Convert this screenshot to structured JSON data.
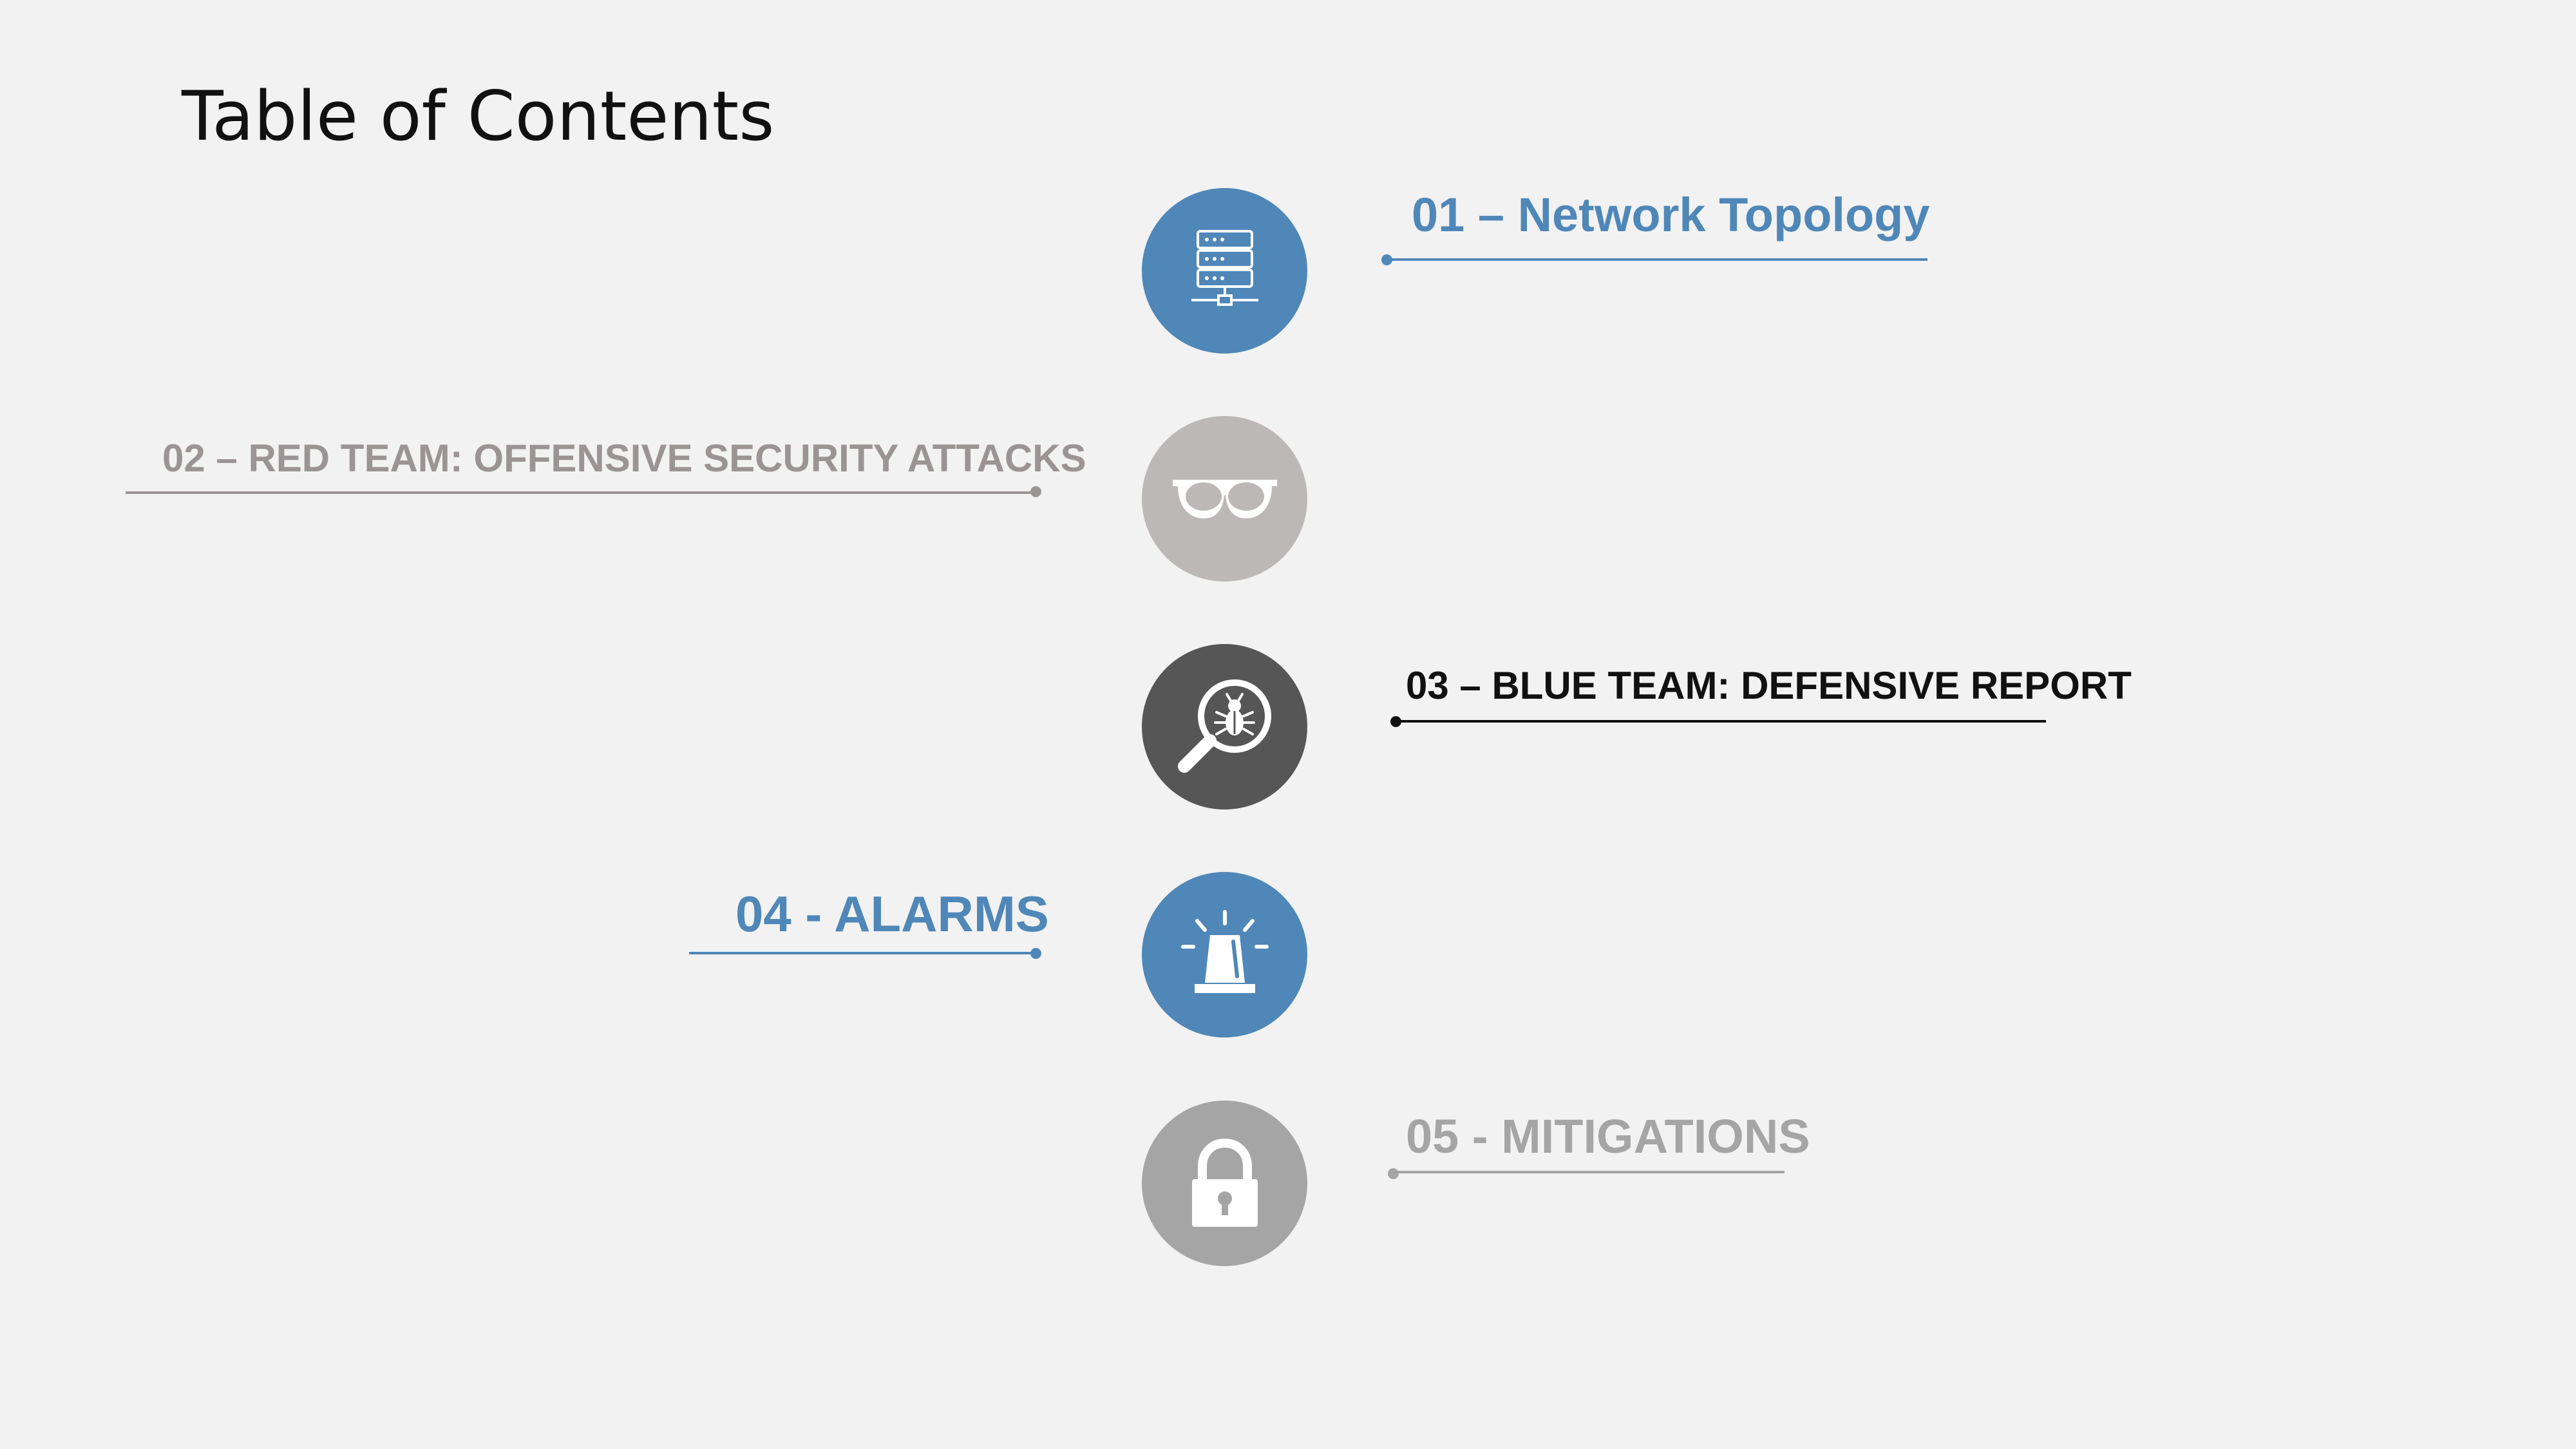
{
  "slide": {
    "title": "Table of Contents",
    "items": [
      {
        "label": "01 – Network Topology",
        "icon": "server-icon",
        "color": "#4f87b8"
      },
      {
        "label": "02 – RED TEAM: OFFENSIVE SECURITY ATTACKS",
        "icon": "glasses-icon",
        "color": "#9b9494"
      },
      {
        "label": "03 – BLUE TEAM: DEFENSIVE REPORT",
        "icon": "bug-search-icon",
        "color": "#111111"
      },
      {
        "label": "04 - ALARMS",
        "icon": "alarm-beacon-icon",
        "color": "#4f87b8"
      },
      {
        "label": "05 - MITIGATIONS",
        "icon": "padlock-icon",
        "color": "#a5a5a5"
      }
    ],
    "circle_colors": [
      "#4f87b8",
      "#bdb8b8",
      "#565656",
      "#4f87b8",
      "#a5a5a5"
    ]
  }
}
